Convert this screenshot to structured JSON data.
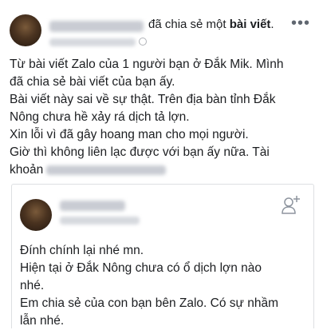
{
  "post": {
    "header_action": "đã chia sẻ một",
    "header_object": "bài viết",
    "header_suffix": ".",
    "more_icon": "more-horizontal-icon",
    "body_lines": [
      "Từ bài viết Zalo của 1 người bạn ở Đắk Mik. Mình",
      "đã chia sẻ bài viết của bạn ấy.",
      "Bài viết này sai về sự thật. Trên địa bàn tỉnh Đắk",
      "Nông chưa hề xảy rá dịch tả lợn.",
      "Xin lỗi vì đã gây hoang man cho mọi người.",
      "Giờ thì không liên lạc được với bạn ấy nữa. Tài",
      "khoản"
    ]
  },
  "shared_post": {
    "add_friend_icon": "add-friend-icon",
    "body_lines": [
      "Đính chính lại nhé mn.",
      "Hiện tại ở Đắk Nông chưa có ổ dịch lợn nào",
      "nhé.",
      "Em chia sẻ của con bạn bên Zalo. Có sự nhầm",
      "lẫn nhé."
    ]
  }
}
